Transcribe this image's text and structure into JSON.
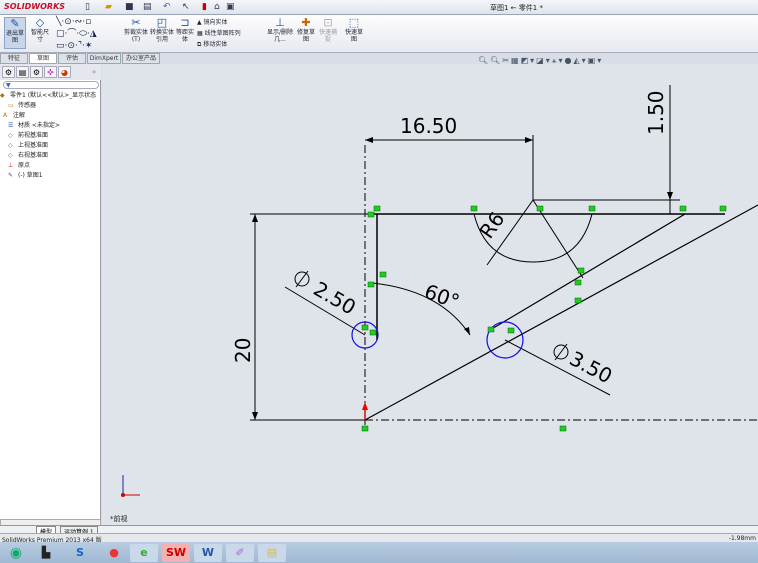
{
  "app": {
    "logo": "SOLIDWORKS",
    "title": "草图1 ← 零件1 *"
  },
  "quick_access": [
    "new-icon",
    "open-icon",
    "save-icon",
    "print-icon",
    "undo-icon",
    "select-icon",
    "rebuild-icon",
    "options-icon",
    "view-icon"
  ],
  "ribbon": {
    "items": [
      {
        "label": "退出草图",
        "icon": "exit-sketch-icon"
      },
      {
        "label": "智能尺寸",
        "icon": "smart-dimension-icon"
      },
      {
        "label": "剪裁实体(T)",
        "icon": "trim-icon"
      },
      {
        "label": "转换实体引用",
        "icon": "convert-icon"
      },
      {
        "label": "等距实体",
        "icon": "offset-icon"
      },
      {
        "label": "显示/删除几...",
        "icon": "relations-icon"
      },
      {
        "label": "修复草图",
        "icon": "repair-icon"
      },
      {
        "label": "快速捕捉",
        "icon": "snap-icon"
      },
      {
        "label": "快速草图",
        "icon": "rapid-sketch-icon"
      }
    ],
    "small": [
      "镜向实体",
      "线性草图阵列",
      "移动实体"
    ]
  },
  "tabs": [
    "特征",
    "草图",
    "评估",
    "DimXpert",
    "办公室产品"
  ],
  "active_tab": "草图",
  "tree": {
    "filter_icon": "filter-icon",
    "items": [
      "零件1 (默认<<默认>_显示状态",
      "传感器",
      "注解",
      "材质 <未指定>",
      "前视基准面",
      "上视基准面",
      "右视基准面",
      "原点",
      "(-) 草图1"
    ]
  },
  "sketch": {
    "dimensions": [
      "16.50",
      "1.50",
      "R6",
      "60°",
      "2.50",
      "3.50",
      "20"
    ],
    "view_label": "*前视"
  },
  "bottom_tabs": [
    "模型",
    "运动算例 1"
  ],
  "status": {
    "left": "SolidWorks Premium 2013 x64 版",
    "right": "-1.98mm"
  },
  "taskbar": [
    "start",
    "app",
    "sogou",
    "player",
    "ie",
    "solidworks",
    "word",
    "paint",
    "explorer"
  ],
  "colors": {
    "sketch_line": "#000000",
    "constraint": "#22cc22",
    "circle": "#1010e0",
    "origin": "#e00000"
  }
}
